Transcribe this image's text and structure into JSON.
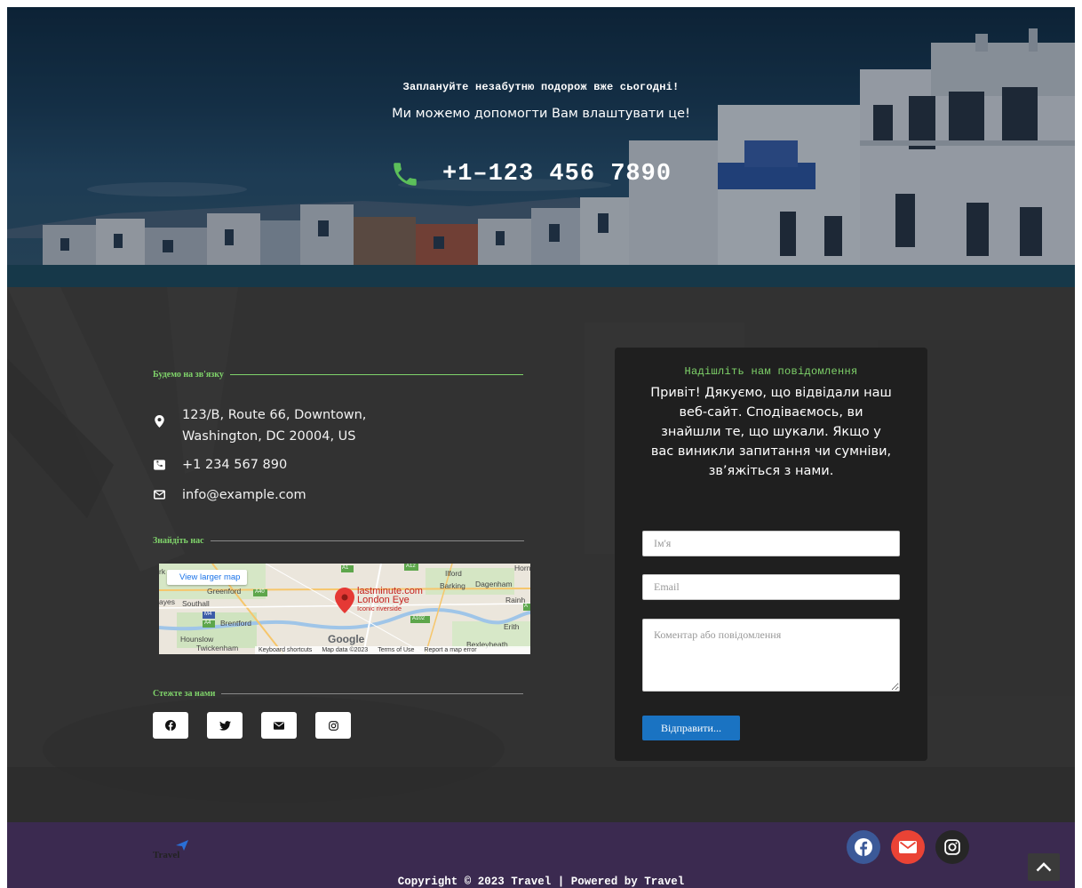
{
  "hero": {
    "kicker": "Заплануйте незабутню подорож вже сьогодні!",
    "subtitle": "Ми можемо допомогти Вам влаштувати це!",
    "phone": "+1–123 456 7890",
    "phone_icon": "phone-icon"
  },
  "contact": {
    "heading_contact": "Будемо на зв'язку",
    "address_line1": "123/B, Route 66, Downtown,",
    "address_line2": "Washington, DC 20004, US",
    "phone": "+1 234 567 890",
    "email": "info@example.com",
    "heading_find": "Знайдіть нас",
    "heading_follow": "Стежте за нами",
    "social": [
      "facebook-icon",
      "twitter-icon",
      "envelope-icon",
      "instagram-icon"
    ]
  },
  "map": {
    "view_larger": "View larger map",
    "poi_name": "lastminute.com",
    "poi_name2": "London Eye",
    "poi_desc": "Iconic riverside",
    "labels": {
      "greenford": "Greenford",
      "southall": "Southall",
      "hayes": "ayes",
      "brentford": "Brentford",
      "hounslow": "Hounslow",
      "twickenham": "Twickenham",
      "ilford": "Ilford",
      "barking": "Barking",
      "dagenham": "Dagenham",
      "rainham": "Rainh",
      "erith": "Erith",
      "bexleyheath": "Bexleyheath",
      "horn": "Horn",
      "rk": "rk",
      "a1": "A1",
      "a12": "A12",
      "a40": "A40",
      "m4": "M4",
      "a4": "A4",
      "a102": "A102",
      "a2": "A"
    },
    "google": "Google",
    "footer": [
      "Keyboard shortcuts",
      "Map data ©2023",
      "Terms of Use",
      "Report a map error"
    ]
  },
  "form": {
    "title": "Надішліть нам повідомлення",
    "text": "Привіт! Дякуємо, що відвідали наш веб-сайт. Сподіваємось, ви знайшли те, що шукали. Якщо у вас виникли запитання чи сумніви, зв’яжіться з нами.",
    "name_placeholder": "Ім'я",
    "email_placeholder": "Email",
    "comment_placeholder": "Коментар або повідомлення",
    "submit_label": "Відправити..."
  },
  "footer": {
    "logo_text": "Travel",
    "copyright": "Copyright © 2023 Travel | Powered by Travel",
    "social": [
      "facebook-icon",
      "envelope-icon",
      "instagram-icon"
    ],
    "colors": {
      "facebook": "#3b5998",
      "mail": "#ea4335",
      "instagram": "#262626"
    }
  },
  "colors": {
    "accent_green": "#7fd36a",
    "footer_bg": "#3b2a50",
    "button_blue": "#1a73c2"
  }
}
